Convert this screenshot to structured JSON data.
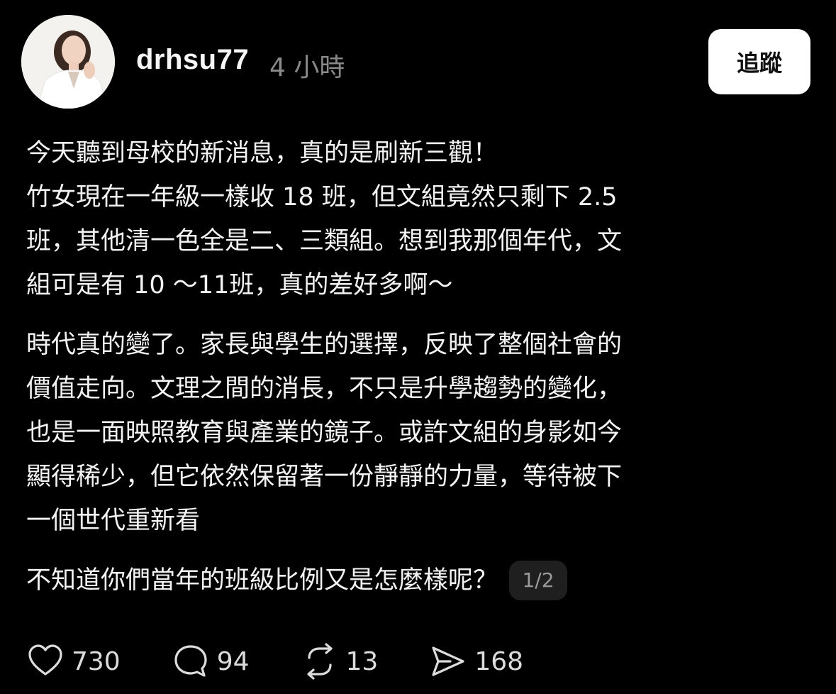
{
  "post": {
    "username": "drhsu77",
    "time": "4 小時",
    "follow_label": "追蹤",
    "paragraphs": [
      {
        "lines": [
          "今天聽到母校的新消息，真的是刷新三觀！"
        ]
      },
      {
        "lines": [
          "竹女現在一年級一樣收 18 班，但文組竟然只剩下 2.5",
          "班，其他清一色全是二、三類組。想到我那個年代，文",
          "組可是有 10 ～11班，真的差好多啊～"
        ]
      },
      {
        "lines": [
          "時代真的變了。家長與學生的選擇，反映了整個社會的",
          "價值走向。文理之間的消長，不只是升學趨勢的變化，",
          "也是一面映照教育與產業的鏡子。或許文組的身影如今",
          "顯得稀少，但它依然保留著一份靜靜的力量，等待被下",
          "一個世代重新看"
        ]
      }
    ],
    "question": "不知道你們當年的班級比例又是怎麼樣呢？",
    "page_indicator": "1/2"
  },
  "actions": {
    "like": {
      "icon": "heart-icon",
      "count": "730"
    },
    "comment": {
      "icon": "comment-bubble-icon",
      "count": "94"
    },
    "repost": {
      "icon": "repost-icon",
      "count": "13"
    },
    "share": {
      "icon": "send-icon",
      "count": "168"
    }
  },
  "colors": {
    "background": "#000000",
    "text": "#f3f3f3",
    "muted": "#8a8a8a",
    "button_bg": "#ffffff",
    "button_text": "#111111"
  }
}
